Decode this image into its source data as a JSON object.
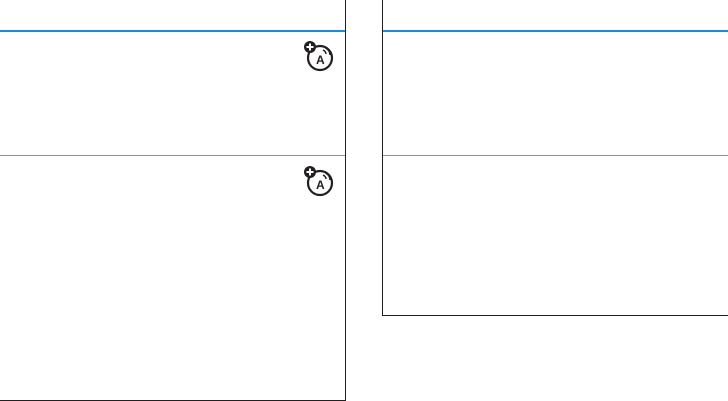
{
  "icons": {
    "network_feature_icon": "network-dependent-feature-icon"
  },
  "colors": {
    "header_rule": "#1f8bd6",
    "row_rule": "#4aa3e0",
    "border": "#231f20",
    "background": "#ffffff"
  }
}
